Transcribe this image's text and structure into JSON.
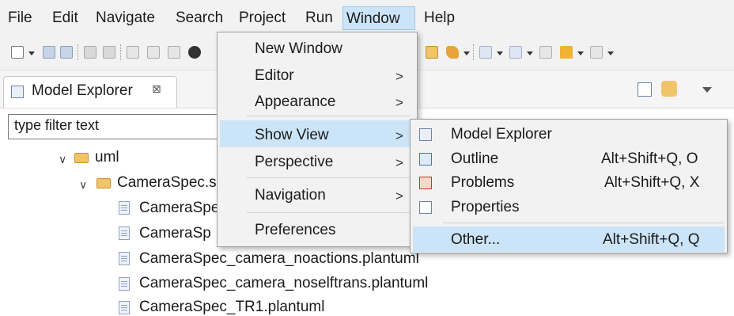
{
  "menubar": {
    "items": [
      "File",
      "Edit",
      "Navigate",
      "Search",
      "Project",
      "Run",
      "Window",
      "Help"
    ],
    "active": "Window"
  },
  "toolbar": {
    "icons": [
      "new-wizard-icon",
      "save-icon",
      "save-all-icon",
      "build-icon",
      "debug-icon",
      "run-icon",
      "open-type-icon",
      "search-icon",
      "next-annotation-icon",
      "prev-annotation-icon",
      "back-icon",
      "forward-icon"
    ]
  },
  "model_explorer": {
    "title": "Model Explorer",
    "close_glyph": "⊠",
    "filter_placeholder": "type filter text",
    "tree": [
      {
        "label": "uml",
        "kind": "folder",
        "expanded": true
      },
      {
        "label": "CameraSpec.s",
        "kind": "folder",
        "expanded": true
      },
      {
        "label": "CameraSpe",
        "kind": "file"
      },
      {
        "label": "CameraSp",
        "kind": "file"
      },
      {
        "label": "CameraSpec_camera_noactions.plantuml",
        "kind": "file"
      },
      {
        "label": "CameraSpec_camera_noselftrans.plantuml",
        "kind": "file"
      },
      {
        "label": "CameraSpec_TR1.plantuml",
        "kind": "file"
      }
    ]
  },
  "window_menu": {
    "items": [
      {
        "label": "New Window",
        "submenu": false
      },
      {
        "label": "Editor",
        "submenu": true
      },
      {
        "label": "Appearance",
        "submenu": true
      },
      {
        "label": "Show View",
        "submenu": true,
        "highlighted": true
      },
      {
        "label": "Perspective",
        "submenu": true
      },
      {
        "label": "Navigation",
        "submenu": true
      },
      {
        "label": "Preferences",
        "submenu": false
      }
    ],
    "arrow_glyph": ">"
  },
  "show_view_menu": {
    "items": [
      {
        "label": "Model Explorer",
        "shortcut": "",
        "icon": "model-explorer-icon"
      },
      {
        "label": "Outline",
        "shortcut": "Alt+Shift+Q, O",
        "icon": "outline-icon"
      },
      {
        "label": "Problems",
        "shortcut": "Alt+Shift+Q, X",
        "icon": "problems-icon"
      },
      {
        "label": "Properties",
        "shortcut": "",
        "icon": "properties-icon"
      },
      {
        "label": "Other...",
        "shortcut": "Alt+Shift+Q, Q",
        "highlighted": true
      }
    ]
  },
  "colors": {
    "menu_bg": "#f2f2f2",
    "highlight": "#cce4f7",
    "folder": "#f1c46b"
  }
}
